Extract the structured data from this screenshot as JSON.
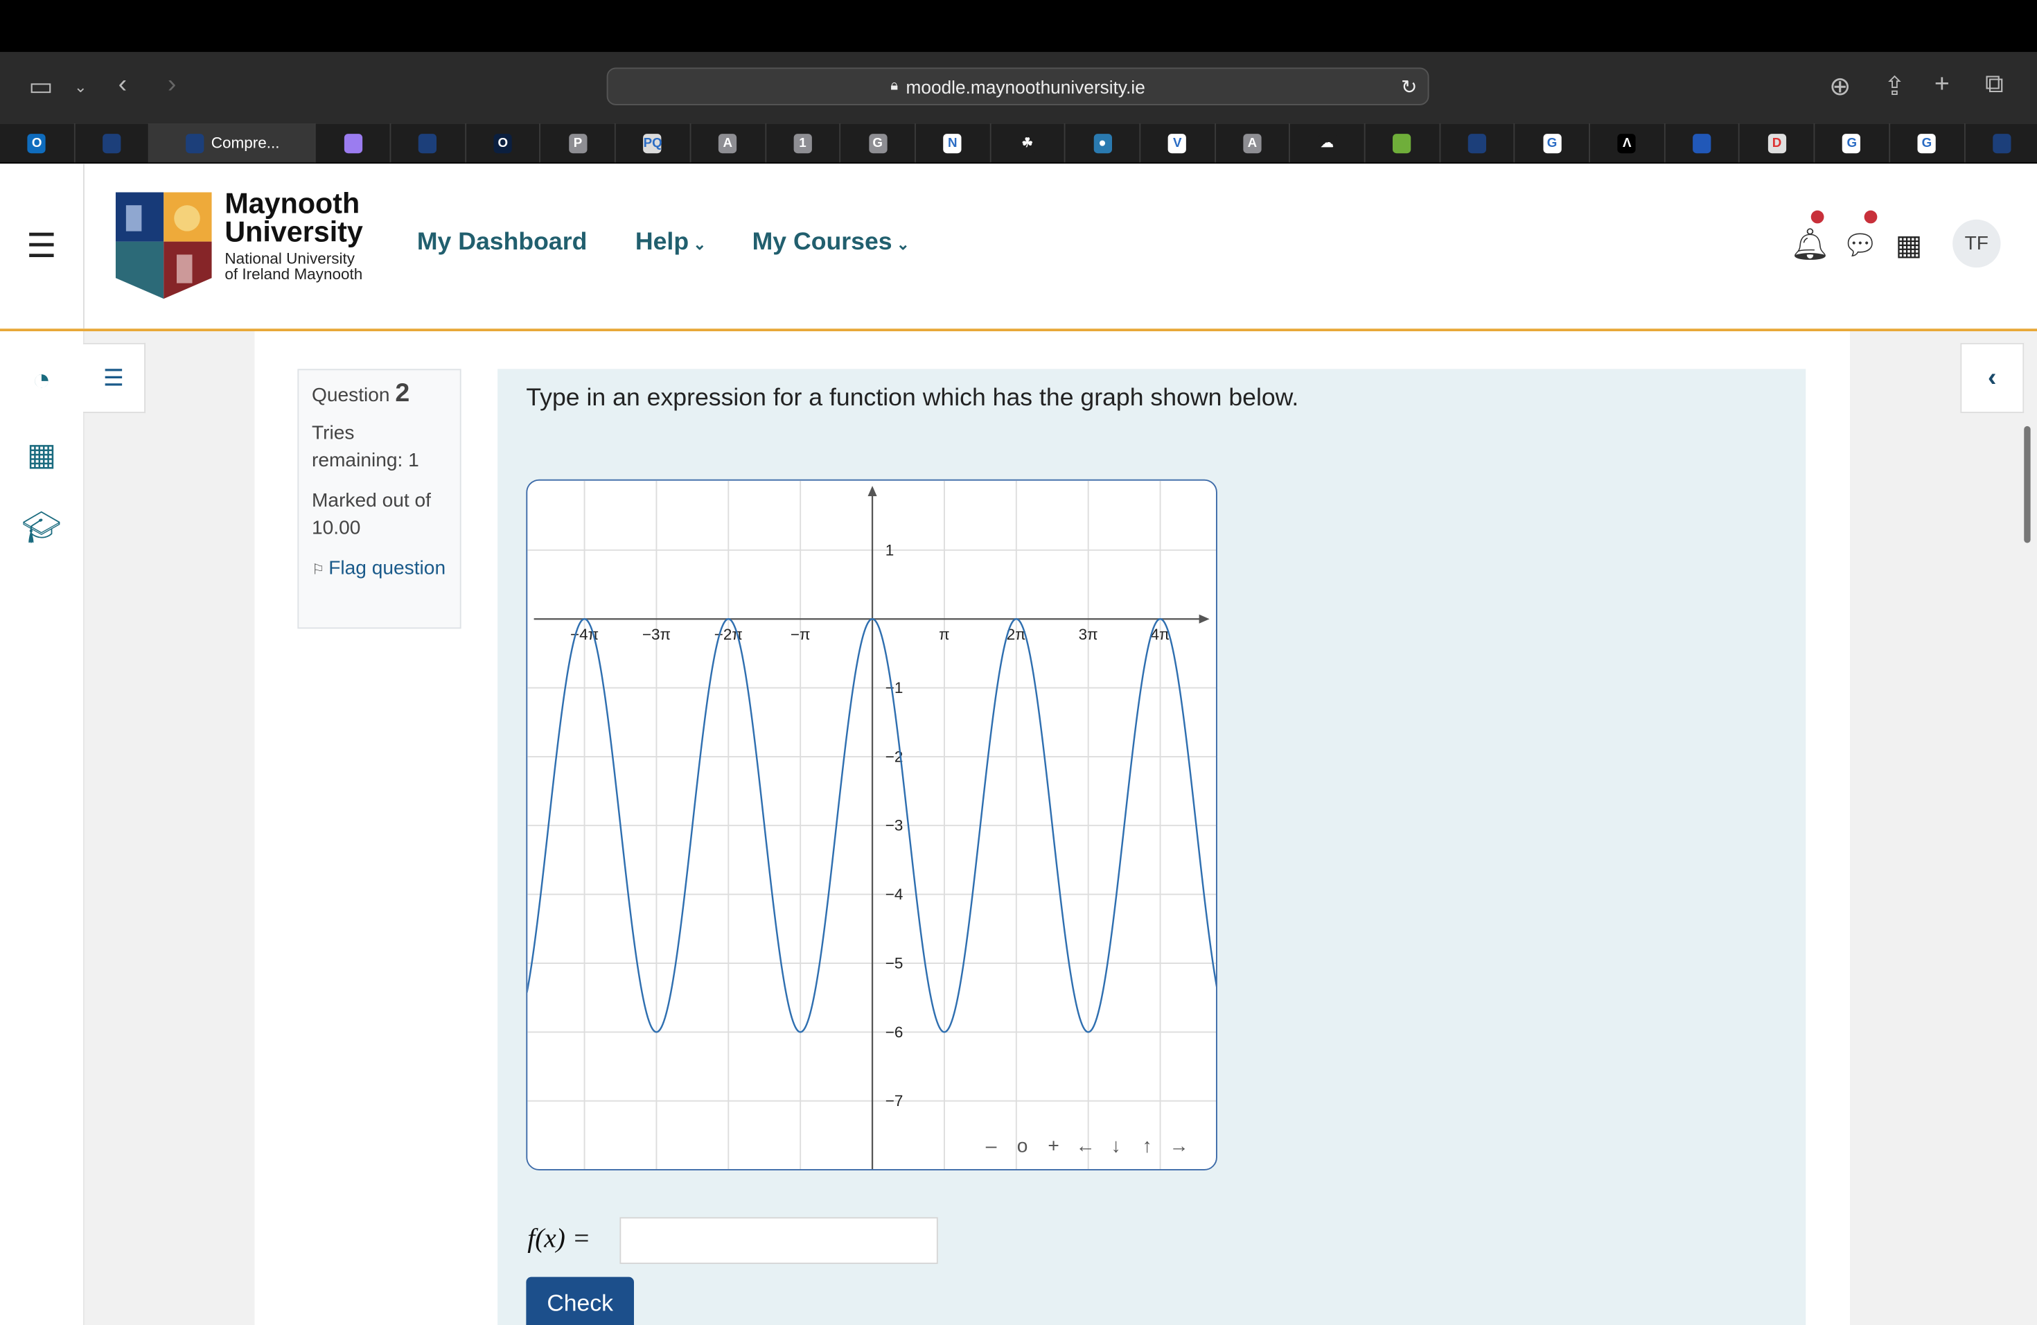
{
  "browser": {
    "url": "moodle.maynoothuniversity.ie",
    "tabs": [
      {
        "icon": "outlook-icon",
        "label": "O",
        "color": "#0f6cbd"
      },
      {
        "icon": "maynooth-icon",
        "label": "",
        "color": "#1c3f7a"
      },
      {
        "icon": "maynooth-icon",
        "label": "Compre...",
        "color": "#1c3f7a",
        "active": true
      },
      {
        "icon": "crystal-icon",
        "label": "",
        "color": "#9b7cf0"
      },
      {
        "icon": "maynooth-icon",
        "label": "",
        "color": "#1c3f7a"
      },
      {
        "icon": "o-icon",
        "label": "O",
        "color": "#0b1f3f"
      },
      {
        "icon": "p-icon",
        "label": "P",
        "color": "#8e8e93"
      },
      {
        "icon": "pq-icon",
        "label": "PQ",
        "color": "#dcdcdc"
      },
      {
        "icon": "a-icon",
        "label": "A",
        "color": "#8e8e93"
      },
      {
        "icon": "one-icon",
        "label": "1",
        "color": "#8e8e93"
      },
      {
        "icon": "g-icon",
        "label": "G",
        "color": "#8e8e93"
      },
      {
        "icon": "notion-icon",
        "label": "N",
        "color": "#ffffff"
      },
      {
        "icon": "clover-icon",
        "label": "☘",
        "color": "#1e1e1e"
      },
      {
        "icon": "globe-icon",
        "label": "●",
        "color": "#2a7ab0"
      },
      {
        "icon": "v-icon",
        "label": "V",
        "color": "#ffffff"
      },
      {
        "icon": "a-icon",
        "label": "A",
        "color": "#8e8e93"
      },
      {
        "icon": "cloud-icon",
        "label": "☁",
        "color": "#1e1e1e"
      },
      {
        "icon": "leaf-icon",
        "label": "",
        "color": "#6fae3a"
      },
      {
        "icon": "maynooth-icon",
        "label": "",
        "color": "#1c3f7a"
      },
      {
        "icon": "google-icon",
        "label": "G",
        "color": "#ffffff"
      },
      {
        "icon": "lambda-icon",
        "label": "Λ",
        "color": "#000000"
      },
      {
        "icon": "book-icon",
        "label": "",
        "color": "#2158b8"
      },
      {
        "icon": "d-icon",
        "label": "D",
        "color": "#e0e0e0"
      },
      {
        "icon": "google-icon",
        "label": "G",
        "color": "#ffffff"
      },
      {
        "icon": "google-icon",
        "label": "G",
        "color": "#ffffff"
      },
      {
        "icon": "maynooth-icon",
        "label": "",
        "color": "#1c3f7a"
      }
    ]
  },
  "header": {
    "logo_line1": "Maynooth",
    "logo_line2": "University",
    "logo_sub1": "National University",
    "logo_sub2": "of Ireland Maynooth",
    "nav": [
      "My Dashboard",
      "Help",
      "My Courses"
    ],
    "avatar": "TF",
    "accent": "#e8a838",
    "nav_color": "#215f6e"
  },
  "question_info": {
    "label": "Question",
    "number": "2",
    "tries": "Tries remaining: 1",
    "marked": "Marked out of 10.00",
    "flag": "Flag question"
  },
  "question": {
    "prompt": "Type in an expression for a function which has the graph shown below.",
    "fx_label": "f(x) =",
    "answer": "",
    "check_label": "Check"
  },
  "graph_controls": [
    "–",
    "o",
    "+",
    "←",
    "↓",
    "↑",
    "→"
  ],
  "chart_data": {
    "type": "line",
    "x_tick_labels": [
      "−4π",
      "−3π",
      "−2π",
      "−π",
      "π",
      "2π",
      "3π",
      "4π"
    ],
    "x_ticks_pi": [
      -4,
      -3,
      -2,
      -1,
      1,
      2,
      3,
      4
    ],
    "y_tick_labels": [
      "1",
      "−1",
      "−2",
      "−3",
      "−4",
      "−5",
      "−6",
      "−7"
    ],
    "y_ticks": [
      1,
      -1,
      -2,
      -3,
      -4,
      -5,
      -6,
      -7
    ],
    "xlim_pi": [
      -4.8,
      4.8
    ],
    "ylim": [
      -7.8,
      1.8
    ],
    "grid": true,
    "series": [
      {
        "maxima_x_pi": [
          -4,
          -2,
          0,
          2,
          4
        ],
        "max_y": 0,
        "minima_x_pi": [
          -3,
          -1,
          1,
          3
        ],
        "min_y": -6,
        "period_pi": 2,
        "color": "#2f6fb0"
      }
    ]
  }
}
